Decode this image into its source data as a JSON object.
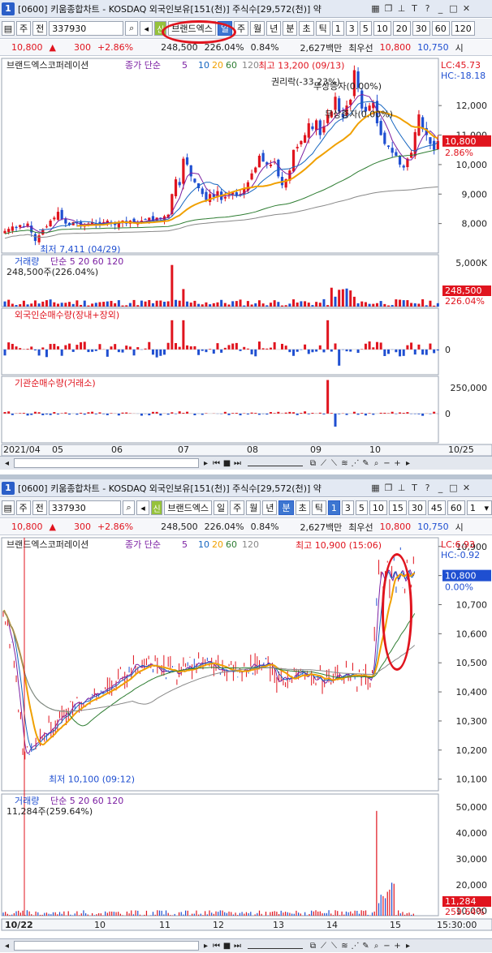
{
  "colors": {
    "up": "#e0141e",
    "down": "#1f4fd1",
    "ma5": "#7b1fa2",
    "ma10": "#1565c0",
    "ma20": "#f0a000",
    "ma60": "#2e7d32",
    "ma120": "#888888",
    "annot": "#e0141e",
    "price_box": "#e0141e"
  },
  "top": {
    "title_bar": {
      "num": "1",
      "text": "[0600] 키움종합차트 - KOSDAQ 외국인보유[151(천)] 주식수[29,572(천)] 약",
      "icons": [
        "grid-icon",
        "copy-icon",
        "pin-icon",
        "text-icon",
        "help-icon",
        "minimize-icon",
        "maximize-icon",
        "close-icon"
      ]
    },
    "toolbar": {
      "market": "주",
      "prev": "전",
      "code": "337930",
      "name": "브랜드엑스",
      "periods": [
        "일",
        "주",
        "월",
        "년",
        "분",
        "초",
        "틱"
      ],
      "selected_period": "일",
      "intervals": [
        "1",
        "3",
        "5",
        "10",
        "20",
        "30",
        "60",
        "120"
      ]
    },
    "quote": {
      "price": "10,800",
      "arrow": "▲",
      "change": "300",
      "rate": "+2.86%",
      "volume": "248,500",
      "vol_rate": "226.04%",
      "turnover": "0.84%",
      "amount": "2,627백만",
      "label": "최우선",
      "bid": "10,800",
      "ask": "10,750",
      "more": "시"
    },
    "chart_data": {
      "type": "candlestick",
      "title": "브랜드엑스코퍼레이션",
      "legend": {
        "label": "종가 단순",
        "periods": [
          "5",
          "10",
          "20",
          "60",
          "120"
        ]
      },
      "lc": "LC:45.73",
      "hc": "HC:-18.18",
      "y_ticks": [
        "12,000",
        "11,000",
        "10,000",
        "9,000",
        "8,000"
      ],
      "ylim": [
        7000,
        13600
      ],
      "x_ticks": [
        "2021/04",
        "05",
        "06",
        "07",
        "08",
        "09",
        "10",
        "10/25"
      ],
      "current_price": "10,800",
      "current_rate": "2.86%",
      "annotations": {
        "high": "최고 13,200 (09/13)",
        "low": "최저 7,411 (04/29)",
        "event1": "권리락(-33.23%)",
        "event2": "무상증자(0.00%)",
        "event3": "무상증자(0.00%)"
      },
      "closes": [
        7750,
        7820,
        7900,
        7850,
        7950,
        7880,
        8000,
        7700,
        7411,
        7600,
        7800,
        7900,
        8100,
        8200,
        8400,
        8150,
        8000,
        7950,
        8050,
        8000,
        7900,
        7950,
        8000,
        8050,
        7980,
        8000,
        8050,
        8100,
        8000,
        7950,
        8050,
        8100,
        8000,
        8100,
        8050,
        8000,
        8100,
        8150,
        8200,
        8100,
        8200,
        8150,
        8250,
        8300,
        9000,
        9500,
        9300,
        10200,
        10000,
        9600,
        9400,
        9200,
        9000,
        8800,
        9000,
        8900,
        9100,
        8800,
        8900,
        9000,
        9050,
        8950,
        9000,
        9200,
        9400,
        9700,
        9900,
        10300,
        10100,
        10000,
        10000,
        10100,
        9600,
        9300,
        9500,
        9800,
        10500,
        10600,
        10800,
        11000,
        11400,
        11200,
        11500,
        11000,
        11300,
        11700,
        11800,
        12300,
        11800,
        11600,
        12000,
        12200,
        13200,
        12600,
        11900,
        11800,
        12000,
        12100,
        11400,
        11000,
        10700,
        10600,
        10400,
        10300,
        10000,
        9900,
        10200,
        10400,
        11100,
        11700,
        11200,
        11000,
        10700,
        10500,
        10800
      ],
      "volume": {
        "label": "거래량",
        "legend": "단순 5 20 60 120",
        "value": "248,500주(226.04%)",
        "y_ticks": [
          "5,000K",
          "0"
        ],
        "current": "248,500",
        "current_rate": "226.04%"
      },
      "foreign": {
        "label": "외국인순매수량(장내+장외)",
        "y_ticks": [
          "0"
        ]
      },
      "inst": {
        "label": "기관순매수량(거래소)",
        "y_ticks": [
          "250,000",
          "0"
        ]
      }
    }
  },
  "bottom": {
    "title_bar": {
      "num": "1",
      "text": "[0600] 키움종합차트 - KOSDAQ 외국인보유[151(천)] 주식수[29,572(천)] 약"
    },
    "toolbar": {
      "market": "주",
      "prev": "전",
      "code": "337930",
      "name": "브랜드엑스",
      "periods": [
        "일",
        "주",
        "월",
        "년",
        "분",
        "초",
        "틱"
      ],
      "selected_period": "분",
      "intervals": [
        "1",
        "3",
        "5",
        "10",
        "15",
        "30",
        "45",
        "60"
      ],
      "selected_interval": "1",
      "dropdown": "1"
    },
    "quote": {
      "price": "10,800",
      "arrow": "▲",
      "change": "300",
      "rate": "+2.86%",
      "volume": "248,500",
      "vol_rate": "226.04%",
      "turnover": "0.84%",
      "amount": "2,627백만",
      "label": "최우선",
      "bid": "10,800",
      "ask": "10,750",
      "more": "시"
    },
    "chart_data": {
      "type": "line",
      "title": "브랜드엑스코퍼레이션",
      "legend": {
        "label": "종가 단순",
        "periods": [
          "5",
          "10",
          "20",
          "60",
          "120"
        ]
      },
      "lc": "LC:6.93",
      "hc": "HC:-0.92",
      "y_ticks": [
        "10,900",
        "10,800",
        "10,700",
        "10,600",
        "10,500",
        "10,400",
        "10,300",
        "10,200",
        "10,100"
      ],
      "ylim": [
        10060,
        10930
      ],
      "x_ticks": [
        "10/22",
        "10",
        "11",
        "12",
        "13",
        "14",
        "15",
        "15:30:00"
      ],
      "current_price": "10,800",
      "current_rate": "0.00%",
      "annotations": {
        "high": "최고 10,900 (15:06)",
        "low": "최저 10,100 (09:12)"
      },
      "volume": {
        "label": "거래량",
        "legend": "단순 5 20 60 120",
        "value": "11,284주(259.64%)",
        "y_ticks": [
          "50,000",
          "40,000",
          "30,000",
          "20,000",
          "10,000"
        ],
        "current": "11,284",
        "current_rate": "259.64%"
      }
    }
  },
  "bottom_bar_icons": [
    "play-icon",
    "rewind-icon",
    "stop-icon",
    "forward-icon",
    "slider-icon",
    "zoom-icon",
    "minus-icon",
    "plus-icon",
    "settings-icon"
  ]
}
